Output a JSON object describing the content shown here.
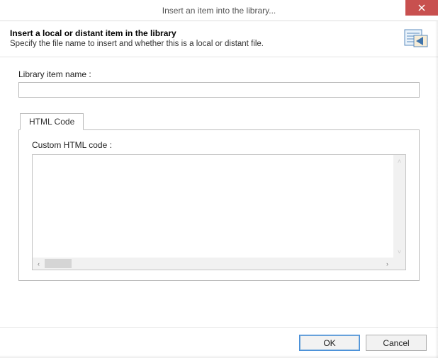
{
  "titlebar": {
    "title": "Insert an item into the library..."
  },
  "header": {
    "title": "Insert a local or distant item in the library",
    "subtitle": "Specify the file name to insert and whether this is a local or distant file."
  },
  "fields": {
    "library_item_label": "Library item name :",
    "library_item_value": ""
  },
  "tab": {
    "label": "HTML Code",
    "inner_label": "Custom HTML code :",
    "code_value": ""
  },
  "footer": {
    "ok": "OK",
    "cancel": "Cancel"
  }
}
